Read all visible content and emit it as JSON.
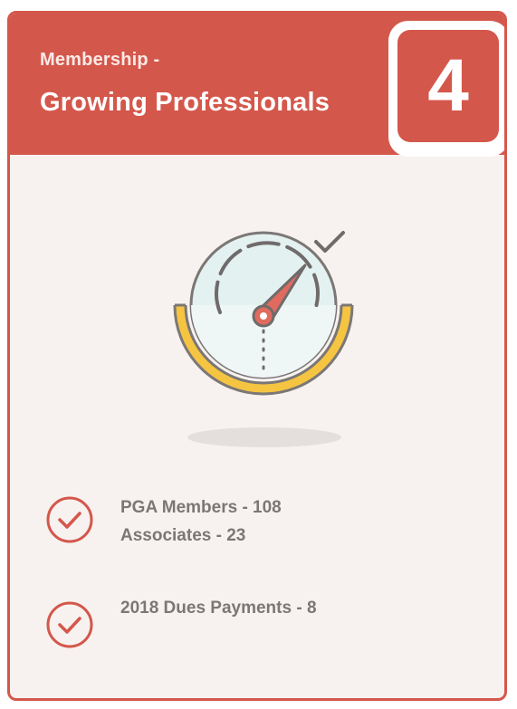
{
  "header": {
    "subtitle": "Membership -",
    "title": "Growing Professionals",
    "number": "4"
  },
  "illustration": {
    "icon": "gauge-speedometer-icon"
  },
  "stats": {
    "group1": {
      "line1": "PGA Members - 108",
      "line2": "Associates - 23"
    },
    "group2": {
      "line1": "2018 Dues Payments - 8"
    }
  },
  "colors": {
    "accent": "#d4574b",
    "card_background": "#f7f2ef",
    "gauge_yellow": "#f5c542",
    "gauge_face": "#e4f1f1",
    "text": "#7b7776"
  }
}
